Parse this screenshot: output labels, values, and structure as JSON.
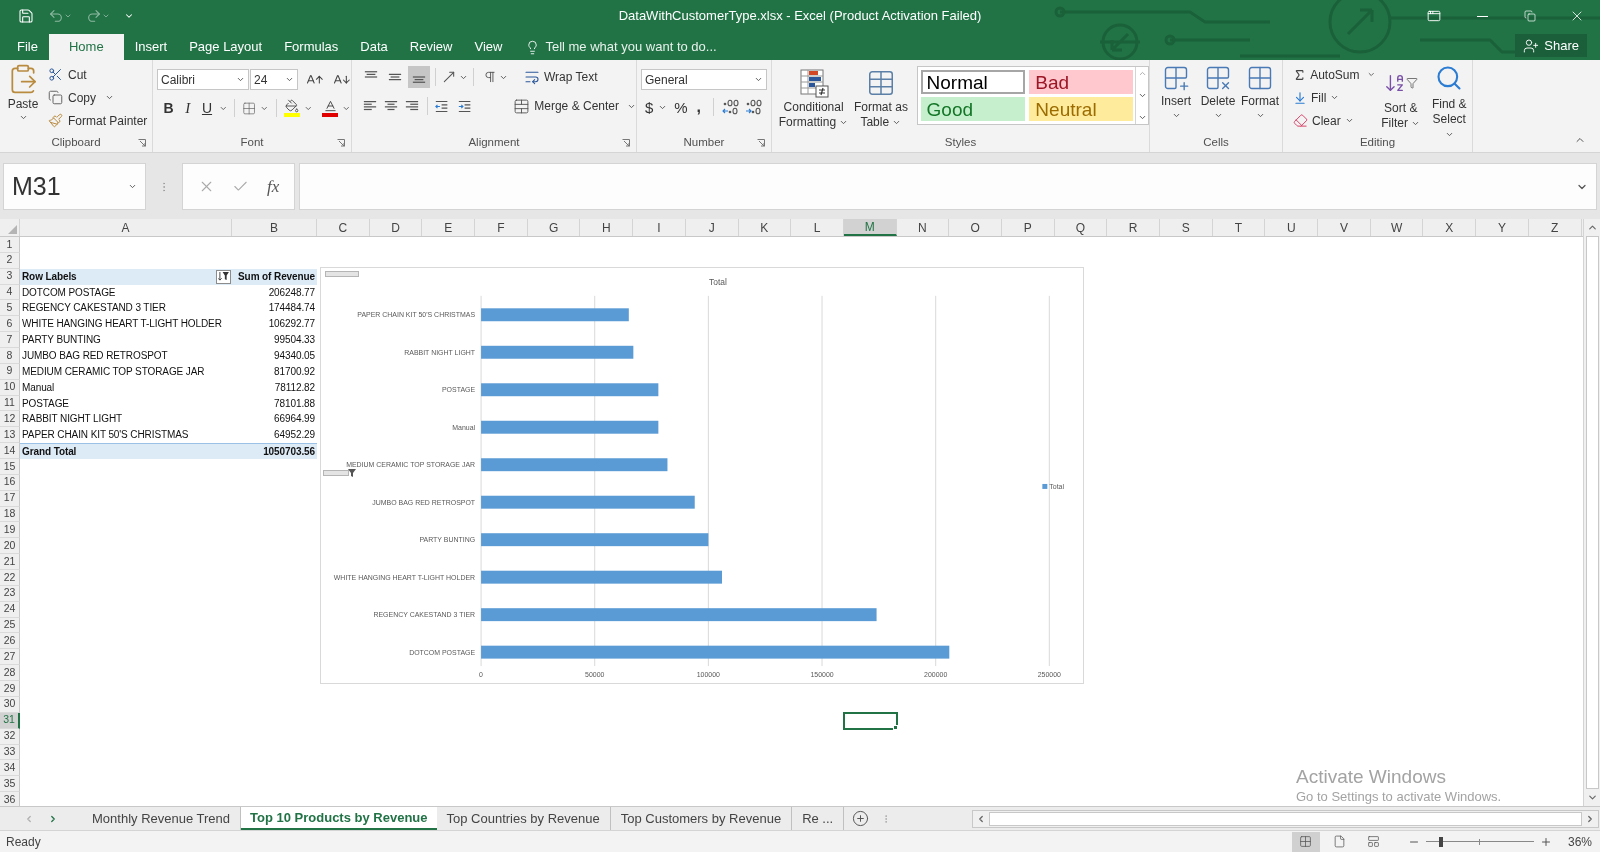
{
  "window": {
    "title": "DataWithCustomerType.xlsx - Excel (Product Activation Failed)"
  },
  "ribbon_tabs": [
    {
      "label": "File",
      "selected": false
    },
    {
      "label": "Home",
      "selected": true
    },
    {
      "label": "Insert",
      "selected": false
    },
    {
      "label": "Page Layout",
      "selected": false
    },
    {
      "label": "Formulas",
      "selected": false
    },
    {
      "label": "Data",
      "selected": false
    },
    {
      "label": "Review",
      "selected": false
    },
    {
      "label": "View",
      "selected": false
    }
  ],
  "tell_me": "Tell me what you want to do...",
  "share": "Share",
  "clipboard": {
    "label": "Clipboard",
    "paste": "Paste",
    "cut": "Cut",
    "copy": "Copy",
    "format_painter": "Format Painter"
  },
  "font": {
    "label": "Font",
    "name": "Calibri",
    "size": "24",
    "bold": "B",
    "italic": "I",
    "underline": "U"
  },
  "alignment": {
    "label": "Alignment",
    "vertical_align": [
      {
        "kind": "top",
        "selected": false
      },
      {
        "kind": "middle",
        "selected": false
      },
      {
        "kind": "bottom",
        "selected": true
      }
    ],
    "wrap_text": "Wrap Text",
    "merge_center": "Merge & Center"
  },
  "number": {
    "label": "Number",
    "format": "General",
    "currency": "$",
    "percent": "%",
    "comma": ","
  },
  "styles": {
    "label": "Styles",
    "conditional_formatting": "Conditional Formatting",
    "format_as_table": "Format as Table",
    "gallery": [
      {
        "label": "Normal",
        "color": "#ffffff",
        "selected": true
      },
      {
        "label": "Bad",
        "color": "#ffc7ce",
        "selected": false
      },
      {
        "label": "Good",
        "color": "#c6efce",
        "selected": false
      },
      {
        "label": "Neutral",
        "color": "#ffeb9c",
        "selected": false
      }
    ]
  },
  "cells": {
    "label": "Cells",
    "buttons": [
      {
        "label": "Insert",
        "kind": "insert"
      },
      {
        "label": "Delete",
        "kind": "delete"
      },
      {
        "label": "Format",
        "kind": "format"
      }
    ]
  },
  "editing": {
    "label": "Editing",
    "autosum": "AutoSum",
    "fill": "Fill",
    "clear": "Clear",
    "sort_filter": "Sort & Filter",
    "find_select": "Find & Select"
  },
  "formula_bar": {
    "name_box": "M31",
    "insert_function": "fx"
  },
  "sheet": {
    "columns": [
      {
        "label": "A",
        "selected": false
      },
      {
        "label": "B",
        "selected": false
      },
      {
        "label": "C",
        "selected": false
      },
      {
        "label": "D",
        "selected": false
      },
      {
        "label": "E",
        "selected": false
      },
      {
        "label": "F",
        "selected": false
      },
      {
        "label": "G",
        "selected": false
      },
      {
        "label": "H",
        "selected": false
      },
      {
        "label": "I",
        "selected": false
      },
      {
        "label": "J",
        "selected": false
      },
      {
        "label": "K",
        "selected": false
      },
      {
        "label": "L",
        "selected": false
      },
      {
        "label": "M",
        "selected": true
      },
      {
        "label": "N",
        "selected": false
      },
      {
        "label": "O",
        "selected": false
      },
      {
        "label": "P",
        "selected": false
      },
      {
        "label": "Q",
        "selected": false
      },
      {
        "label": "R",
        "selected": false
      },
      {
        "label": "S",
        "selected": false
      },
      {
        "label": "T",
        "selected": false
      },
      {
        "label": "U",
        "selected": false
      },
      {
        "label": "V",
        "selected": false
      },
      {
        "label": "W",
        "selected": false
      },
      {
        "label": "X",
        "selected": false
      },
      {
        "label": "Y",
        "selected": false
      },
      {
        "label": "Z",
        "selected": false
      }
    ],
    "rows": [
      {
        "label": "1",
        "selected": false
      },
      {
        "label": "2",
        "selected": false
      },
      {
        "label": "3",
        "selected": false
      },
      {
        "label": "4",
        "selected": false
      },
      {
        "label": "5",
        "selected": false
      },
      {
        "label": "6",
        "selected": false
      },
      {
        "label": "7",
        "selected": false
      },
      {
        "label": "8",
        "selected": false
      },
      {
        "label": "9",
        "selected": false
      },
      {
        "label": "10",
        "selected": false
      },
      {
        "label": "11",
        "selected": false
      },
      {
        "label": "12",
        "selected": false
      },
      {
        "label": "13",
        "selected": false
      },
      {
        "label": "14",
        "selected": false
      },
      {
        "label": "15",
        "selected": false
      },
      {
        "label": "16",
        "selected": false
      },
      {
        "label": "17",
        "selected": false
      },
      {
        "label": "18",
        "selected": false
      },
      {
        "label": "19",
        "selected": false
      },
      {
        "label": "20",
        "selected": false
      },
      {
        "label": "21",
        "selected": false
      },
      {
        "label": "22",
        "selected": false
      },
      {
        "label": "23",
        "selected": false
      },
      {
        "label": "24",
        "selected": false
      },
      {
        "label": "25",
        "selected": false
      },
      {
        "label": "26",
        "selected": false
      },
      {
        "label": "27",
        "selected": false
      },
      {
        "label": "28",
        "selected": false
      },
      {
        "label": "29",
        "selected": false
      },
      {
        "label": "30",
        "selected": false
      },
      {
        "label": "31",
        "selected": true
      },
      {
        "label": "32",
        "selected": false
      },
      {
        "label": "33",
        "selected": false
      },
      {
        "label": "34",
        "selected": false
      },
      {
        "label": "35",
        "selected": false
      },
      {
        "label": "36",
        "selected": false
      }
    ],
    "pivot_table": {
      "header": {
        "row_labels": "Row Labels",
        "values": "Sum of Revenue"
      },
      "rows": [
        {
          "label": "DOTCOM POSTAGE",
          "value": "206248.77"
        },
        {
          "label": "REGENCY CAKESTAND 3 TIER",
          "value": "174484.74"
        },
        {
          "label": "WHITE HANGING HEART T-LIGHT HOLDER",
          "value": "106292.77"
        },
        {
          "label": "PARTY BUNTING",
          "value": "99504.33"
        },
        {
          "label": "JUMBO BAG RED RETROSPOT",
          "value": "94340.05"
        },
        {
          "label": "MEDIUM CERAMIC TOP STORAGE JAR",
          "value": "81700.92"
        },
        {
          "label": "Manual",
          "value": "78112.82"
        },
        {
          "label": "POSTAGE",
          "value": "78101.88"
        },
        {
          "label": "RABBIT NIGHT LIGHT",
          "value": "66964.99"
        },
        {
          "label": "PAPER CHAIN KIT 50'S CHRISTMAS",
          "value": "64952.29"
        }
      ],
      "total": {
        "label": "Grand Total",
        "value": "1050703.56"
      }
    },
    "chart_data": [
      {
        "type": "bar",
        "orientation": "horizontal",
        "title": "Total",
        "categories": [
          "PAPER CHAIN KIT 50'S CHRISTMAS",
          "RABBIT NIGHT LIGHT",
          "POSTAGE",
          "Manual",
          "MEDIUM CERAMIC TOP STORAGE JAR",
          "JUMBO BAG RED RETROSPOT",
          "PARTY BUNTING",
          "WHITE HANGING HEART T-LIGHT HOLDER",
          "REGENCY CAKESTAND 3 TIER",
          "DOTCOM POSTAGE"
        ],
        "series": [
          {
            "name": "Total",
            "color": "#5b9bd5",
            "values": [
              65000,
              67000,
              78000,
              78000,
              82000,
              94000,
              100000,
              106000,
              174000,
              206000
            ]
          }
        ],
        "xlim": [
          0,
          250000
        ],
        "xticks": [
          0,
          50000,
          100000,
          150000,
          200000,
          250000
        ],
        "grid": true,
        "legend": "right"
      }
    ]
  },
  "activation_notice": {
    "title": "Activate Windows",
    "message": "Go to Settings to activate Windows."
  },
  "sheet_tabs": [
    {
      "label": "Monthly Revenue Trend",
      "selected": false
    },
    {
      "label": "Top 10 Products by Revenue",
      "selected": true
    },
    {
      "label": "Top Countries by Revenue",
      "selected": false
    },
    {
      "label": "Top Customers by Revenue",
      "selected": false
    },
    {
      "label": "Re ...",
      "selected": false
    }
  ],
  "status_bar": {
    "status": "Ready",
    "views": [
      {
        "kind": "normal",
        "selected": true
      },
      {
        "kind": "page_layout",
        "selected": false
      },
      {
        "kind": "page_break",
        "selected": false
      }
    ],
    "zoom": {
      "level": 0.14,
      "reading": "36%"
    }
  }
}
